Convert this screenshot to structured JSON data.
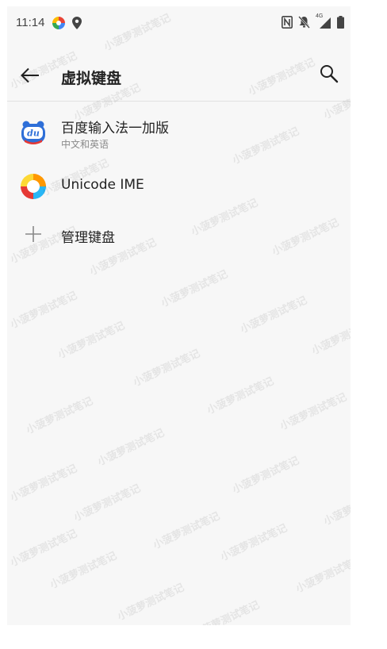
{
  "status_bar": {
    "time": "11:14",
    "icons": [
      "multicolor-app-icon",
      "location-icon",
      "nfc-icon",
      "mute-icon",
      "signal-4g-icon",
      "battery-icon"
    ],
    "network_label": "4G"
  },
  "toolbar": {
    "title": "虚拟键盘",
    "back_icon": "arrow-left-icon",
    "search_icon": "search-icon"
  },
  "keyboards": [
    {
      "title": "百度输入法一加版",
      "subtitle": "中文和英语",
      "icon": "baidu-ime-icon"
    },
    {
      "title": "Unicode IME",
      "subtitle": "",
      "icon": "unicode-ime-icon"
    }
  ],
  "manage": {
    "label": "管理键盘",
    "icon": "plus-icon"
  },
  "watermark": {
    "text": "小菠萝测试笔记"
  },
  "colors": {
    "background": "#f7f7f7",
    "primary_text": "#222222",
    "secondary_text": "#8a8a8a"
  }
}
